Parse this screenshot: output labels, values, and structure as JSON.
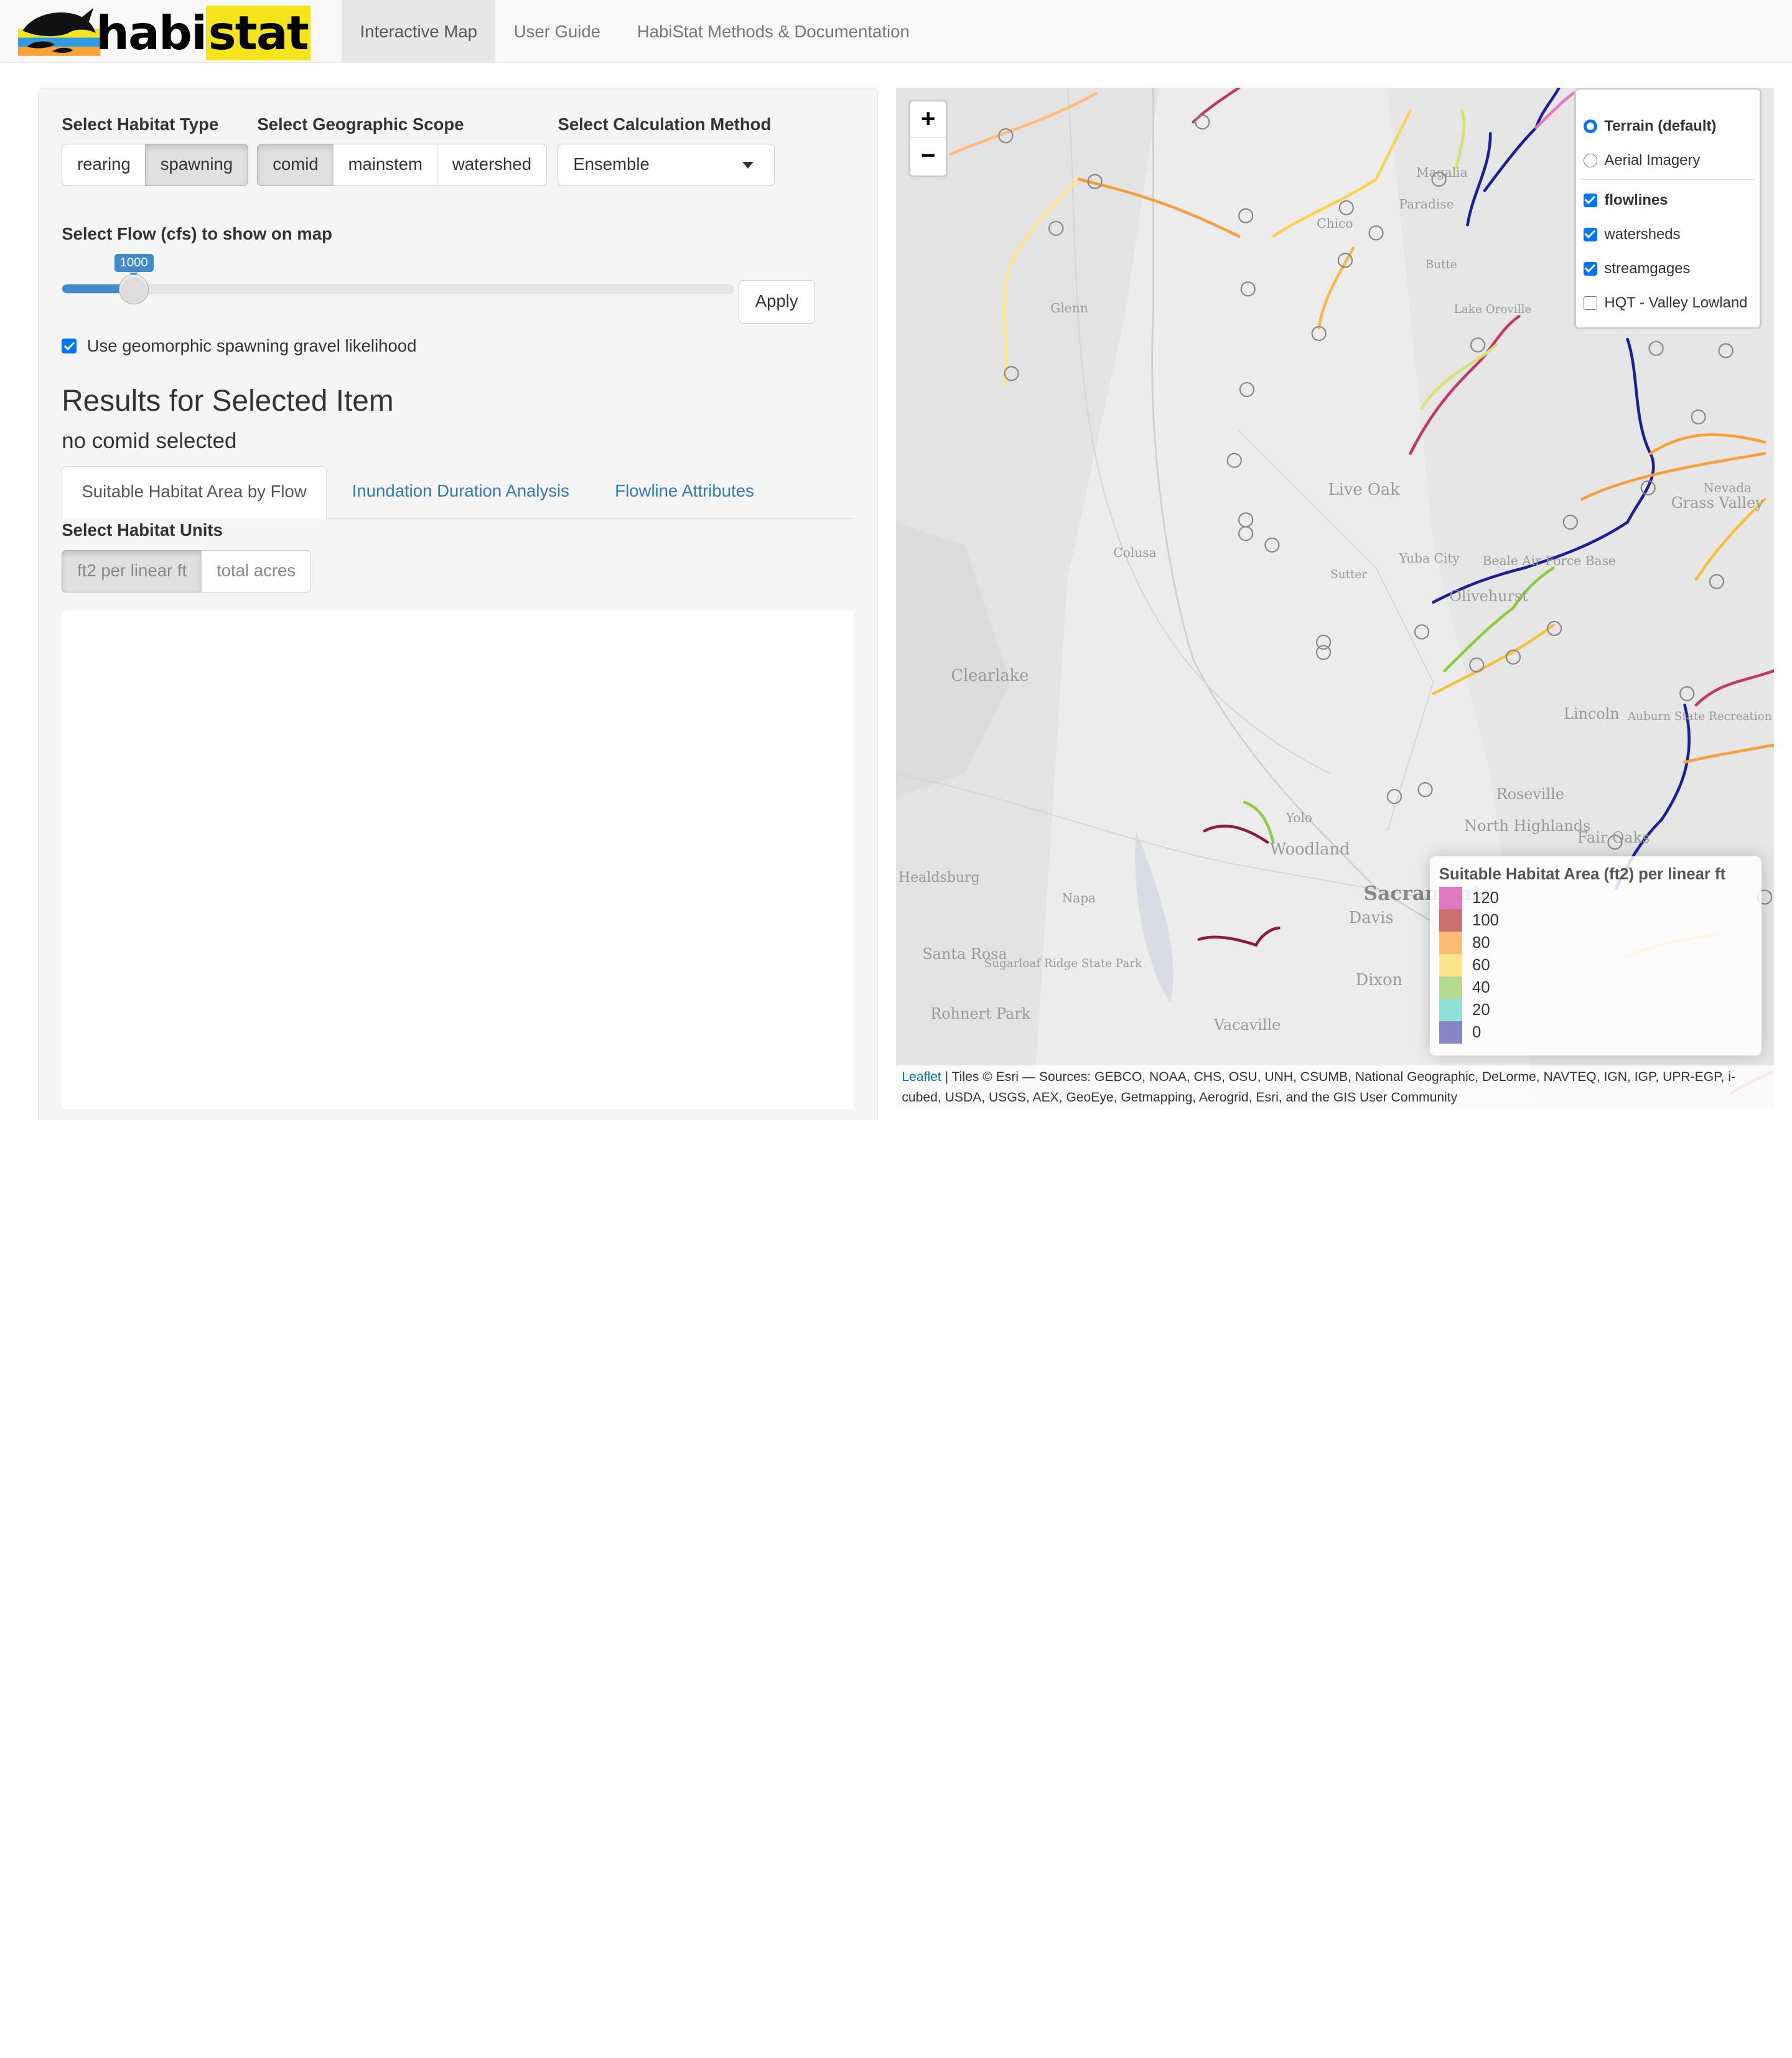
{
  "navbar": {
    "logo_prefix": "habi",
    "logo_suffix": "stat",
    "tabs": [
      {
        "label": "Interactive Map",
        "active": true
      },
      {
        "label": "User Guide",
        "active": false
      },
      {
        "label": "HabiStat Methods & Documentation",
        "active": false
      }
    ]
  },
  "controls": {
    "habitat_type": {
      "label": "Select Habitat Type",
      "options": [
        "rearing",
        "spawning"
      ],
      "selected": "spawning"
    },
    "geographic_scope": {
      "label": "Select Geographic Scope",
      "options": [
        "comid",
        "mainstem",
        "watershed"
      ],
      "selected": "comid"
    },
    "calculation_method": {
      "label": "Select Calculation Method",
      "value": "Ensemble"
    },
    "flow": {
      "label": "Select Flow (cfs) to show on map",
      "value": "1000",
      "fraction": 0.107,
      "apply_label": "Apply"
    },
    "gravel_checkbox": {
      "label": "Use geomorphic spawning gravel likelihood",
      "checked": true
    }
  },
  "results": {
    "title": "Results for Selected Item",
    "subtitle": "no comid selected",
    "tabs": [
      {
        "label": "Suitable Habitat Area by Flow",
        "active": true
      },
      {
        "label": "Inundation Duration Analysis",
        "active": false
      },
      {
        "label": "Flowline Attributes",
        "active": false
      }
    ],
    "units": {
      "label": "Select Habitat Units",
      "options": [
        "ft2 per linear ft",
        "total acres"
      ],
      "selected": "ft2 per linear ft"
    }
  },
  "map": {
    "zoom_in": "+",
    "zoom_out": "−",
    "base_layers": [
      {
        "label": "Terrain (default)",
        "checked": true
      },
      {
        "label": "Aerial Imagery",
        "checked": false
      }
    ],
    "overlays": [
      {
        "label": "flowlines",
        "checked": true
      },
      {
        "label": "watersheds",
        "checked": true
      },
      {
        "label": "streamgages",
        "checked": true
      },
      {
        "label": "HQT - Valley Lowland",
        "checked": false
      }
    ],
    "legend": {
      "title": "Suitable Habitat Area (ft2) per linear ft",
      "items": [
        {
          "label": "120",
          "color": "#e377c2"
        },
        {
          "label": "100",
          "color": "#c97171"
        },
        {
          "label": "80",
          "color": "#ffbb78"
        },
        {
          "label": "60",
          "color": "#ffe58a"
        },
        {
          "label": "40",
          "color": "#b5dc8c"
        },
        {
          "label": "20",
          "color": "#8ee2d7"
        },
        {
          "label": "0",
          "color": "#8686c9"
        }
      ]
    },
    "attribution_link": "Leaflet",
    "attribution_text": " | Tiles © Esri — Sources: GEBCO, NOAA, CHS, OSU, UNH, CSUMB, National Geographic, DeLorme, NAVTEQ, IGN, IGP, UPR-EGP, i-cubed, USDA, USGS, AEX, GeoEye, Getmapping, Aerogrid, Esri, and the GIS User Community",
    "places": [
      {
        "name": "Glenn"
      },
      {
        "name": "Chico"
      },
      {
        "name": "Paradise"
      },
      {
        "name": "Magalia"
      },
      {
        "name": "Butte"
      },
      {
        "name": "Lake Oroville"
      },
      {
        "name": "Live Oak"
      },
      {
        "name": "Colusa"
      },
      {
        "name": "Yuba City"
      },
      {
        "name": "Beale Air Force Base"
      },
      {
        "name": "Olivehurst"
      },
      {
        "name": "Grass Valley"
      },
      {
        "name": "Nevada"
      },
      {
        "name": "Clearlake"
      },
      {
        "name": "Lincoln"
      },
      {
        "name": "Roseville"
      },
      {
        "name": "North Highlands"
      },
      {
        "name": "Fair Oaks"
      },
      {
        "name": "Woodland"
      },
      {
        "name": "Yolo"
      },
      {
        "name": "Napa"
      },
      {
        "name": "Davis"
      },
      {
        "name": "Sacramento"
      },
      {
        "name": "Dixon"
      },
      {
        "name": "Santa Rosa"
      },
      {
        "name": "Sugarloaf Ridge State Park"
      },
      {
        "name": "Rohnert Park"
      },
      {
        "name": "Vacaville"
      },
      {
        "name": "Sutter"
      },
      {
        "name": "Healdsburg"
      },
      {
        "name": "Auburn State Recreation Area"
      }
    ]
  }
}
